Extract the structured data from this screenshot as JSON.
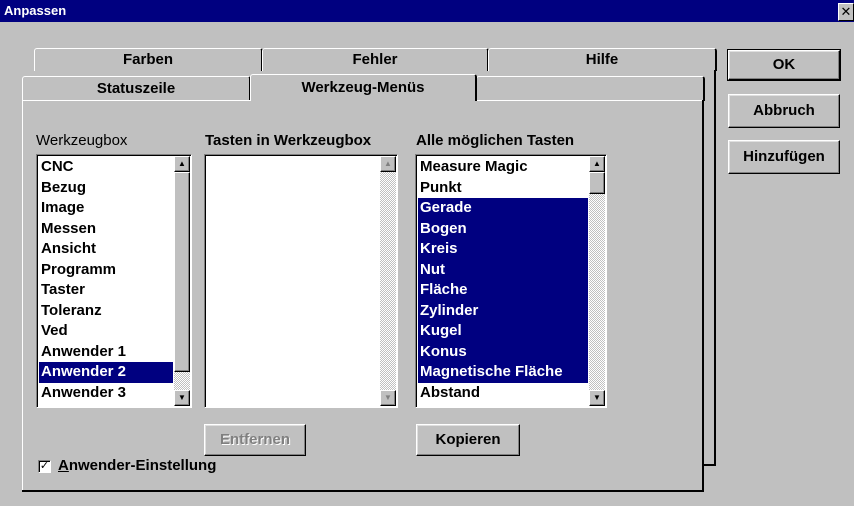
{
  "window": {
    "title": "Anpassen",
    "close_glyph": "✕"
  },
  "tabs": {
    "back_row": [
      "Farben",
      "Fehler",
      "Hilfe"
    ],
    "front_row": [
      "Statuszeile",
      "Werkzeug-Menüs"
    ],
    "active": "Werkzeug-Menüs"
  },
  "buttons": {
    "ok": "OK",
    "cancel": "Abbruch",
    "add": "Hinzufügen",
    "remove": "Entfernen",
    "copy": "Kopieren"
  },
  "labels": {
    "toolbox": "Werkzeugbox",
    "keys_in_toolbox": "Tasten in Werkzeugbox",
    "all_keys": "Alle möglichen Tasten"
  },
  "toolbox_list": {
    "items": [
      "CNC",
      "Bezug",
      "Image",
      "Messen",
      "Ansicht",
      "Programm",
      "Taster",
      "Toleranz",
      "Ved",
      "Anwender 1",
      "Anwender 2",
      "Anwender 3"
    ],
    "selected": [
      "Anwender 2"
    ]
  },
  "keys_in_toolbox_list": {
    "items": []
  },
  "all_keys_list": {
    "items": [
      "Measure Magic",
      "Punkt",
      "Gerade",
      "Bogen",
      "Kreis",
      "Nut",
      "Fläche",
      "Zylinder",
      "Kugel",
      "Konus",
      "Magnetische Fläche",
      "Abstand"
    ],
    "selected": [
      "Gerade",
      "Bogen",
      "Kreis",
      "Nut",
      "Fläche",
      "Zylinder",
      "Kugel",
      "Konus",
      "Magnetische Fläche"
    ]
  },
  "user_setting": {
    "accel": "A",
    "rest": "nwender-Einstellung",
    "checked": true,
    "check_glyph": "✓"
  },
  "scroll": {
    "up_glyph": "▲",
    "down_glyph": "▼"
  },
  "colors": {
    "selection": "#000080",
    "face": "#c0c0c0",
    "title_bar": "#000080"
  }
}
